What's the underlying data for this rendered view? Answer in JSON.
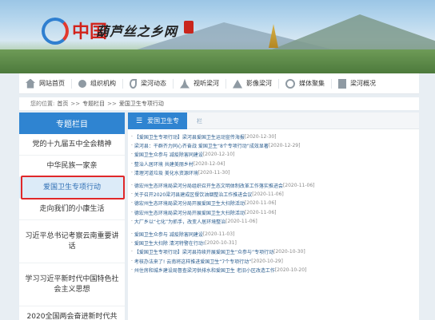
{
  "banner": {
    "logo_red_text": "中国",
    "logo_text": "葫芦丝之乡网"
  },
  "nav": [
    {
      "label": "网站首页",
      "icon": "home-icon"
    },
    {
      "label": "组织机构",
      "icon": "org-icon"
    },
    {
      "label": "梁河动态",
      "icon": "news-icon"
    },
    {
      "label": "视听梁河",
      "icon": "video-icon"
    },
    {
      "label": "影像梁河",
      "icon": "image-icon"
    },
    {
      "label": "媒体聚集",
      "icon": "media-icon"
    },
    {
      "label": "梁河概况",
      "icon": "info-icon"
    }
  ],
  "breadcrumb": {
    "prefix": "您的位置:",
    "home": "首页",
    "sep": ">>",
    "section": "专题栏目",
    "current": "爱国卫生专项行动"
  },
  "sidebar": {
    "heading": "专题栏目",
    "items": [
      "党的十九届五中全会精神",
      "中华民族一家亲",
      "爱国卫生专项行动",
      "走向我们的小康生活",
      "习近平总书记考察云南重要讲话",
      "学习习近平新时代中国特色社会主义思想",
      "2020全国两会奋进新时代共"
    ],
    "active_index": 2
  },
  "main": {
    "tab_label": "爱国卫生专",
    "tab_ghost": "栏",
    "items": [
      {
        "title": "【爱国卫生专项行动】梁河县爱国卫生运动宣传海报",
        "date": "[2020-12-30]"
      },
      {
        "title": "梁河县：干群齐力同心齐奋战 爱国卫生“8个专项行动”成效显著",
        "date": "[2020-12-29]"
      },
      {
        "title": "爱国卫生众参与 减疫除害同建设",
        "date": "[2020-12-10]"
      },
      {
        "title": "整治人居环境 共建美丽乡村",
        "date": "[2020-12-04]"
      },
      {
        "title": "清理河道垃圾 美化水资源环境",
        "date": "[2020-11-30]"
      },
      {
        "title": "德宏州生态环境局梁河分局组织召开生态文明体制改革工作落实推进会",
        "date": "[2020-11-06]"
      },
      {
        "title": "关于召开2020梁河县建成区餐饮油烟整治工作推进会议",
        "date": "[2020-11-06]"
      },
      {
        "title": "德宏州生态环境局梁河分局开展爱国卫生大扫除活动",
        "date": "[2020-11-06]"
      },
      {
        "title": "德宏州生态环境局梁河分局开展爱国卫生大扫除活动",
        "date": "[2020-11-06]"
      },
      {
        "title": "大厂乡以“七化”为抓手，改变人居环境整治",
        "date": "[2020-11-06]"
      },
      {
        "title": "爱国卫生众参与 减疫除害同建设",
        "date": "[2020-11-03]"
      },
      {
        "title": "爱国卫生大扫除 清河特警在行动!",
        "date": "[2020-10-31]"
      },
      {
        "title": "【爱国卫生专项行动】梁河县持续开展爱国卫生“众参与”专项行动",
        "date": "[2020-10-30]"
      },
      {
        "title": "考核办法来了! 云南将这样推进爱国卫生“7个专项行动”",
        "date": "[2020-10-29]"
      },
      {
        "title": "州住房和城乡建设局督查梁河供排水和爱国卫生 老旧小区改造工作",
        "date": "[2020-10-20]"
      }
    ]
  }
}
